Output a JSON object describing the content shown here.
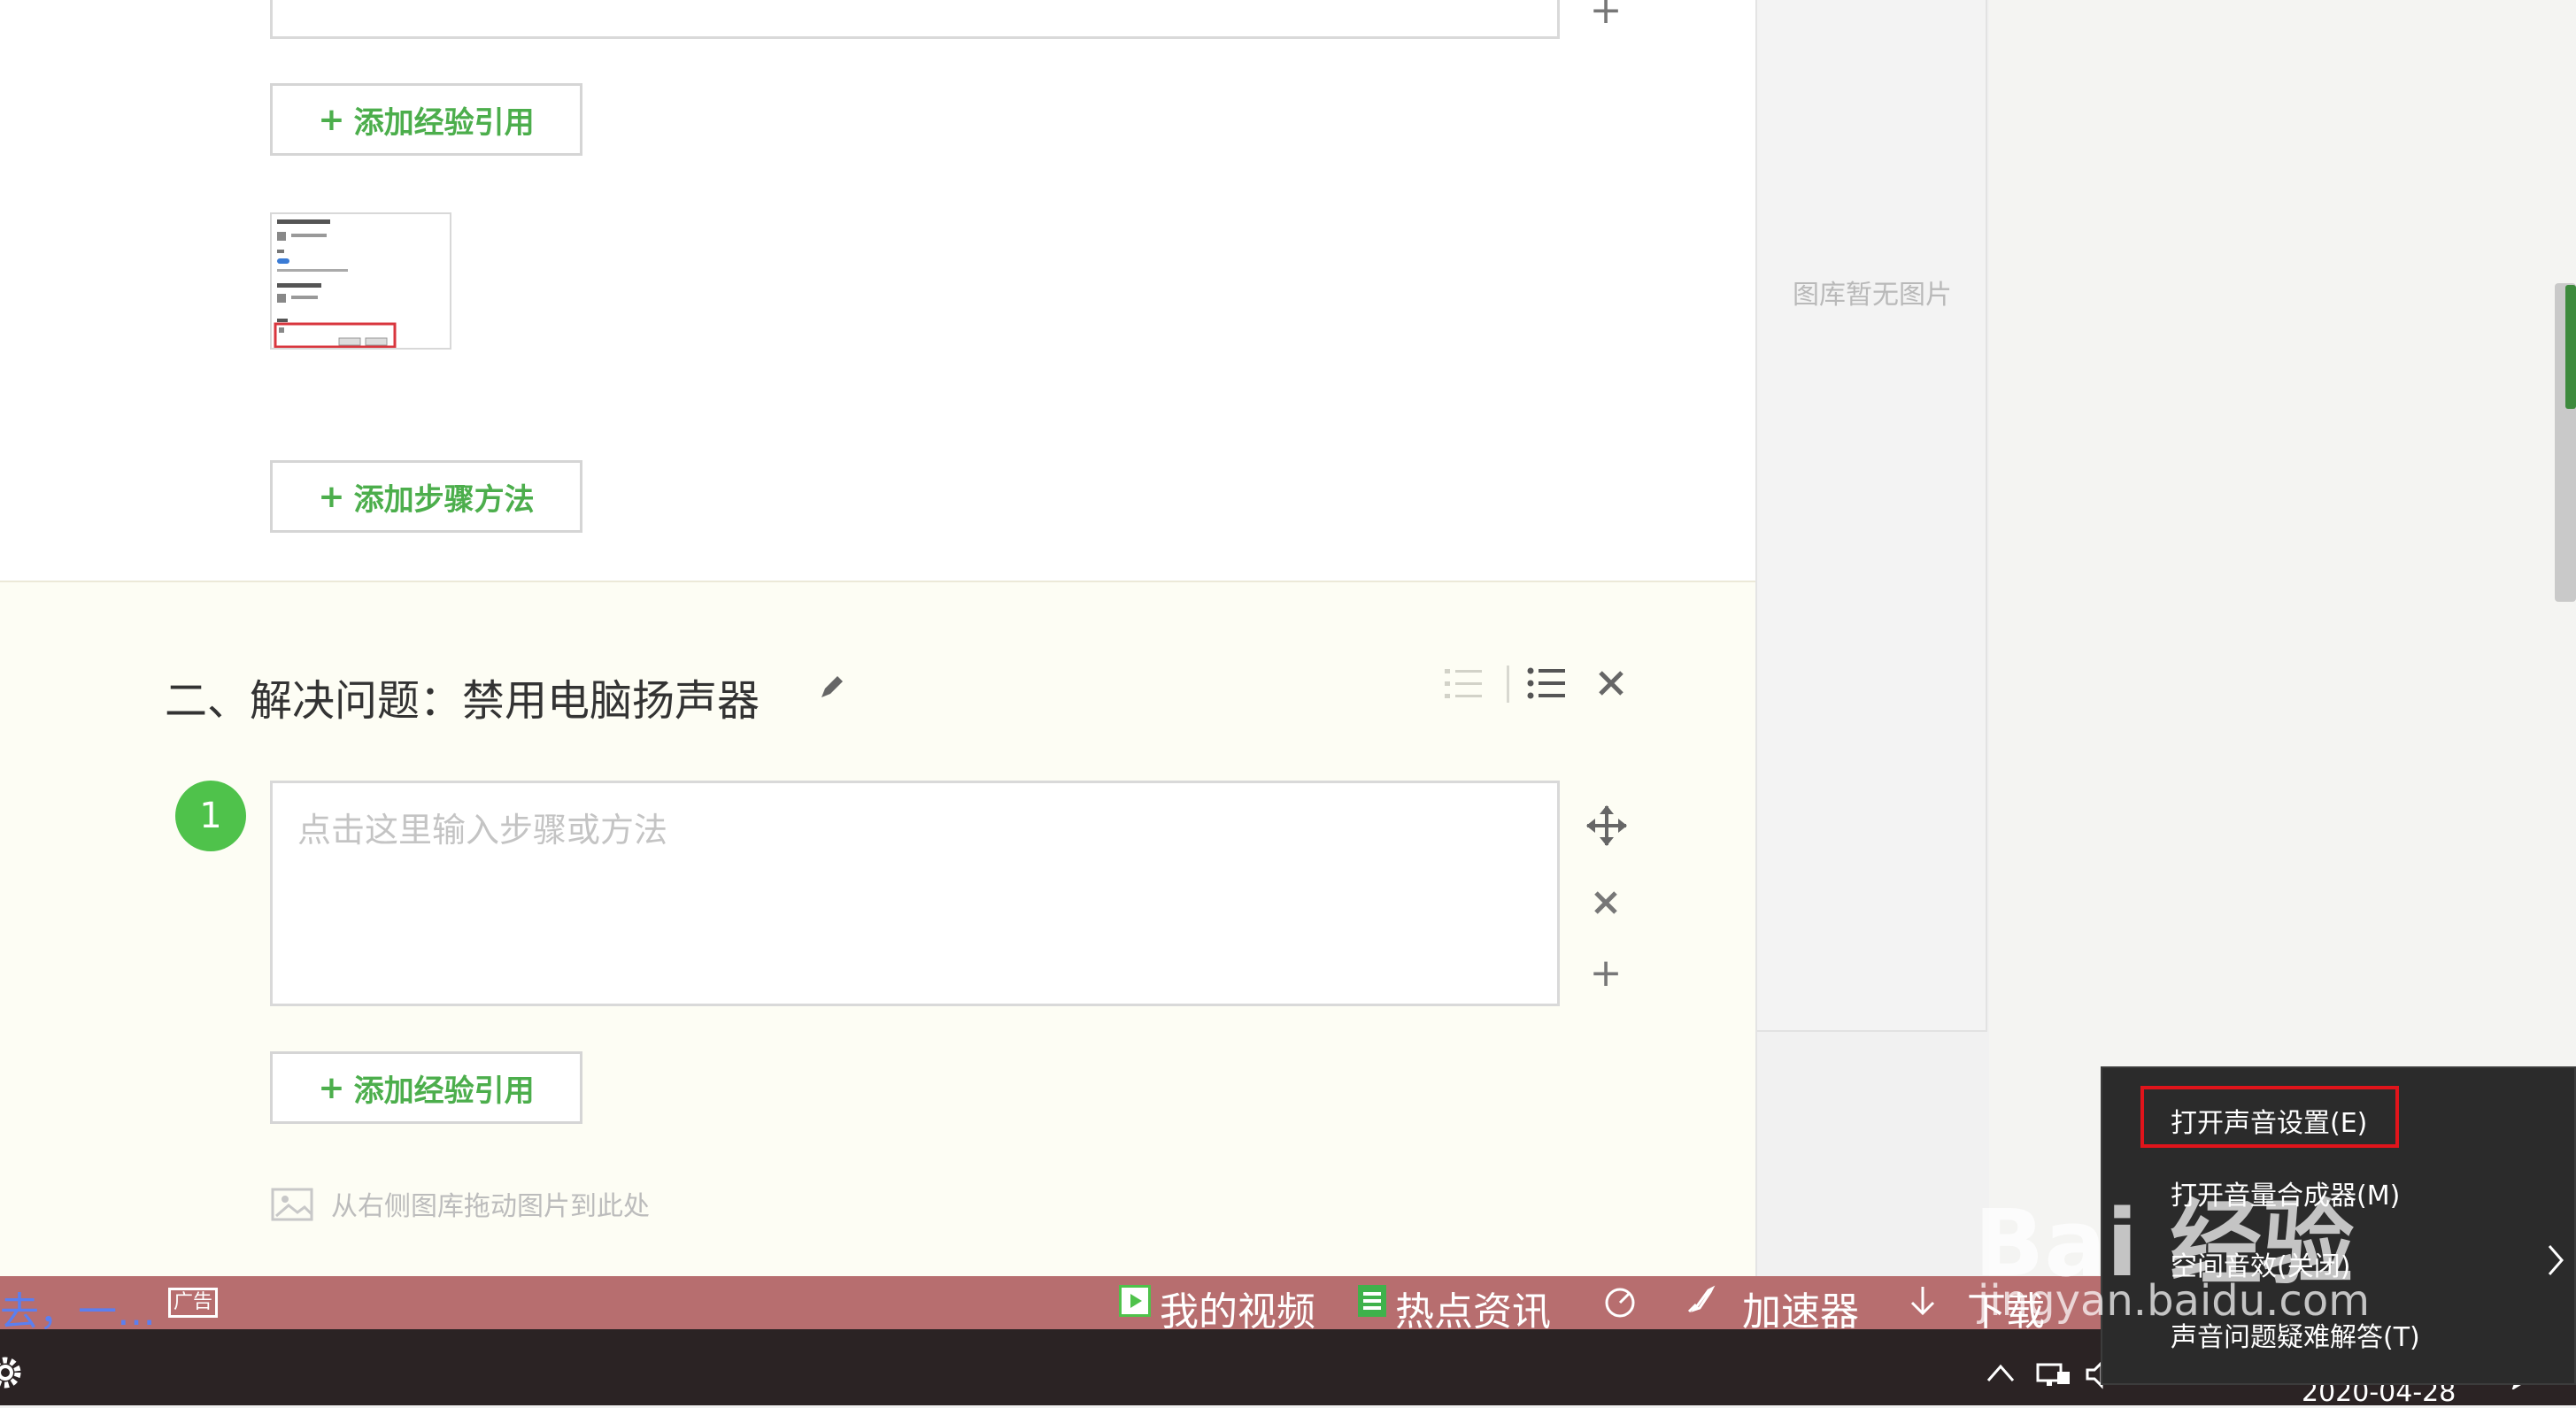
{
  "editor": {
    "top_section": {
      "add_reference_label": "添加经验引用",
      "add_step_label": "添加步骤方法",
      "plus_symbol": "+",
      "thumbnail_alt": "screenshot thumbnail"
    },
    "section_two": {
      "title": "二、解决问题：禁用电脑扬声器",
      "step_number": "1",
      "step_placeholder": "点击这里输入步骤或方法",
      "add_reference_label": "添加经验引用",
      "drag_hint": "从右侧图库拖动图片到此处",
      "plus_symbol": "+"
    }
  },
  "gallery": {
    "empty_text": "图库暂无图片"
  },
  "statusbar": {
    "left_text": "去，一…",
    "left_icon_label": "广告",
    "items": [
      "我的视频",
      "热点资讯",
      "加速器",
      "下载"
    ]
  },
  "taskbar": {
    "date": "2020-04-28"
  },
  "context_menu": {
    "items": [
      "打开声音设置(E)",
      "打开音量合成器(M)",
      "空间音效(关闭)",
      "声音问题疑难解答(T)"
    ]
  },
  "watermark": {
    "brand": "Bai 经验",
    "domain": "jingyan.baidu.com"
  },
  "colors": {
    "accent_green": "#4cae4c",
    "highlight_red": "#e0141b",
    "statusbar": "#b76e6f"
  }
}
